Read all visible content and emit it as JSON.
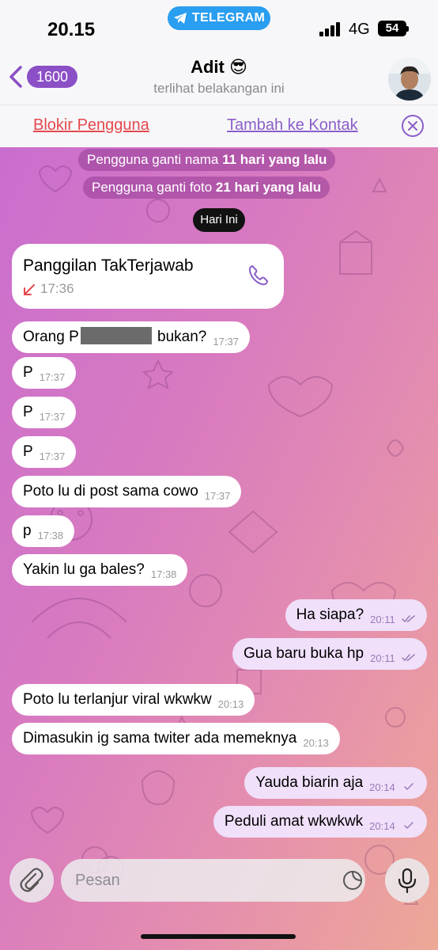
{
  "status_bar": {
    "time": "20.15",
    "app_pill": "TELEGRAM",
    "network": "4G",
    "battery": "54"
  },
  "header": {
    "back_count": "1600",
    "title": "Adit 😎",
    "subtitle": "terlihat belakangan ini"
  },
  "actions": {
    "block_label": "Blokir Pengguna",
    "add_contact_label": "Tambah ke Kontak"
  },
  "service_messages": [
    {
      "prefix": "Pengguna ganti nama ",
      "bold": "11 hari yang lalu"
    },
    {
      "prefix": "Pengguna ganti foto ",
      "bold": "21 hari yang lalu"
    }
  ],
  "date_divider": "Hari Ini",
  "call": {
    "title": "Panggilan TakTerjawab",
    "time": "17:36"
  },
  "messages": [
    {
      "dir": "in",
      "text_before": "Orang P",
      "text_after": " bukan?",
      "time": "17:37",
      "redacted": true
    },
    {
      "dir": "in",
      "text": "P",
      "time": "17:37"
    },
    {
      "dir": "in",
      "text": "P",
      "time": "17:37"
    },
    {
      "dir": "in",
      "text": "P",
      "time": "17:37"
    },
    {
      "dir": "in",
      "text": "Poto lu di post sama cowo",
      "time": "17:37"
    },
    {
      "dir": "in",
      "text": "p",
      "time": "17:38"
    },
    {
      "dir": "in",
      "text": "Yakin lu ga bales?",
      "time": "17:38"
    },
    {
      "dir": "out",
      "text": "Ha siapa?",
      "time": "20:11",
      "read": true
    },
    {
      "dir": "out",
      "text": "Gua baru buka hp",
      "time": "20:11",
      "read": true
    },
    {
      "dir": "in",
      "text": "Poto lu terlanjur viral wkwkw",
      "time": "20:13"
    },
    {
      "dir": "in",
      "text": "Dimasukin ig sama twiter ada memeknya",
      "time": "20:13"
    },
    {
      "dir": "out",
      "text": "Yauda biarin aja",
      "time": "20:14",
      "read": false
    },
    {
      "dir": "out",
      "text": "Peduli amat wkwkwk",
      "time": "20:14",
      "read": false
    }
  ],
  "composer": {
    "placeholder": "Pesan"
  },
  "colors": {
    "accent": "#8b4fc6",
    "block_red": "#e5484d",
    "telegram_blue": "#2a9ef0",
    "outgoing_bubble": "#f0e0fa"
  }
}
